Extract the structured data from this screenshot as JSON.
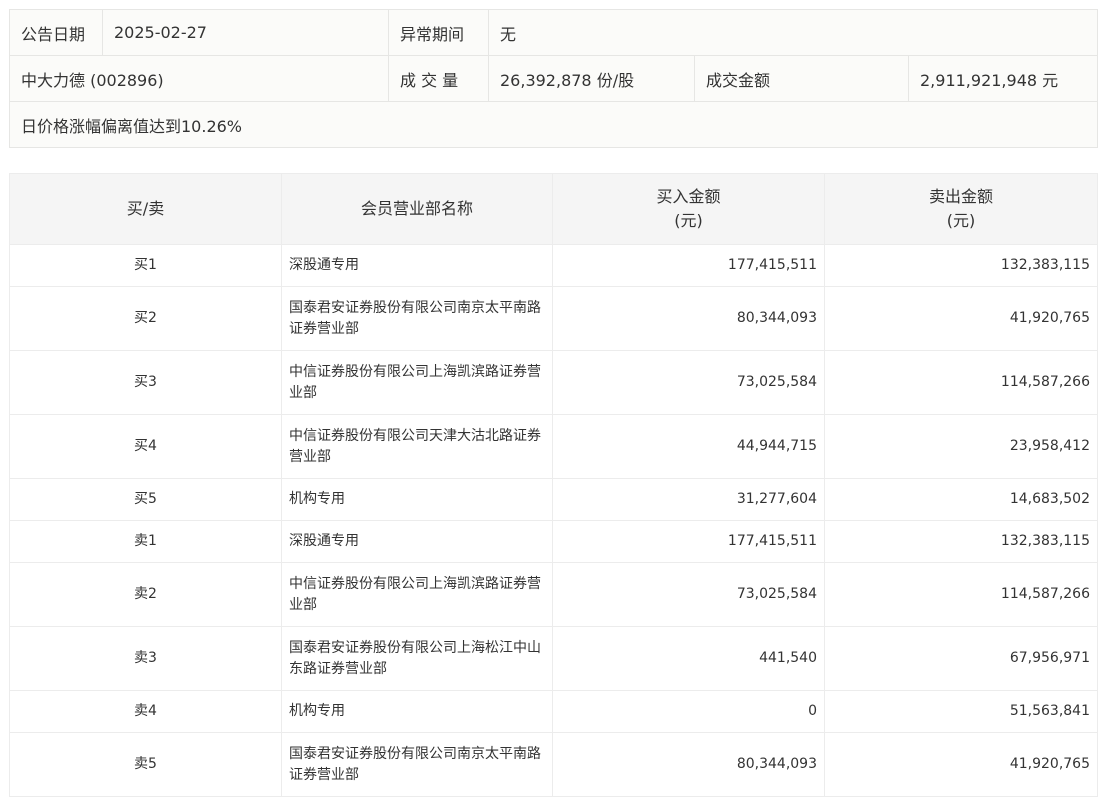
{
  "info": {
    "date_label": "公告日期",
    "date_value": "2025-02-27",
    "period_label": "异常期间",
    "period_value": "无",
    "stock": "中大力德 (002896)",
    "volume_label": "成 交 量",
    "volume_value": "26,392,878 份/股",
    "amount_label": "成交金额",
    "amount_value": "2,911,921,948 元",
    "reason": "日价格涨幅偏离值达到10.26%"
  },
  "table": {
    "headers": {
      "side": "买/卖",
      "name": "会员营业部名称",
      "buy": "买入金额",
      "buy_unit": "(元)",
      "sell": "卖出金额",
      "sell_unit": "(元)"
    },
    "rows": [
      {
        "side": "买1",
        "name": "深股通专用",
        "buy": "177,415,511",
        "sell": "132,383,115"
      },
      {
        "side": "买2",
        "name": "国泰君安证券股份有限公司南京太平南路证券营业部",
        "buy": "80,344,093",
        "sell": "41,920,765"
      },
      {
        "side": "买3",
        "name": "中信证券股份有限公司上海凯滨路证券营业部",
        "buy": "73,025,584",
        "sell": "114,587,266"
      },
      {
        "side": "买4",
        "name": "中信证券股份有限公司天津大沽北路证券营业部",
        "buy": "44,944,715",
        "sell": "23,958,412"
      },
      {
        "side": "买5",
        "name": "机构专用",
        "buy": "31,277,604",
        "sell": "14,683,502"
      },
      {
        "side": "卖1",
        "name": "深股通专用",
        "buy": "177,415,511",
        "sell": "132,383,115"
      },
      {
        "side": "卖2",
        "name": "中信证券股份有限公司上海凯滨路证券营业部",
        "buy": "73,025,584",
        "sell": "114,587,266"
      },
      {
        "side": "卖3",
        "name": "国泰君安证券股份有限公司上海松江中山东路证券营业部",
        "buy": "441,540",
        "sell": "67,956,971"
      },
      {
        "side": "卖4",
        "name": "机构专用",
        "buy": "0",
        "sell": "51,563,841"
      },
      {
        "side": "卖5",
        "name": "国泰君安证券股份有限公司南京太平南路证券营业部",
        "buy": "80,344,093",
        "sell": "41,920,765"
      }
    ]
  }
}
